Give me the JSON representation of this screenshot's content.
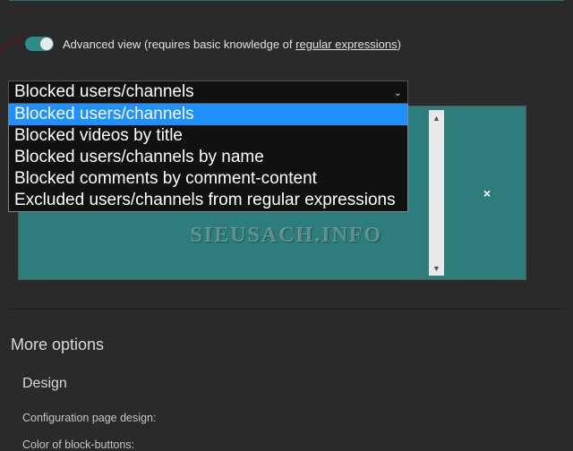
{
  "advanced_view": {
    "label_pre": "Advanced view (requires basic knowledge of ",
    "label_link": "regular expressions",
    "label_post": ")"
  },
  "dropdown": {
    "selected": "Blocked users/channels",
    "options": [
      "Blocked users/channels",
      "Blocked videos by title",
      "Blocked users/channels by name",
      "Blocked comments by comment-content",
      "Excluded users/channels from regular expressions"
    ]
  },
  "close_label": "×",
  "watermark": "SIEUSACH.INFO",
  "sections": {
    "more_options": "More options",
    "design": "Design",
    "config_page_design": "Configuration page design:",
    "color_block_buttons": "Color of block-buttons:"
  }
}
